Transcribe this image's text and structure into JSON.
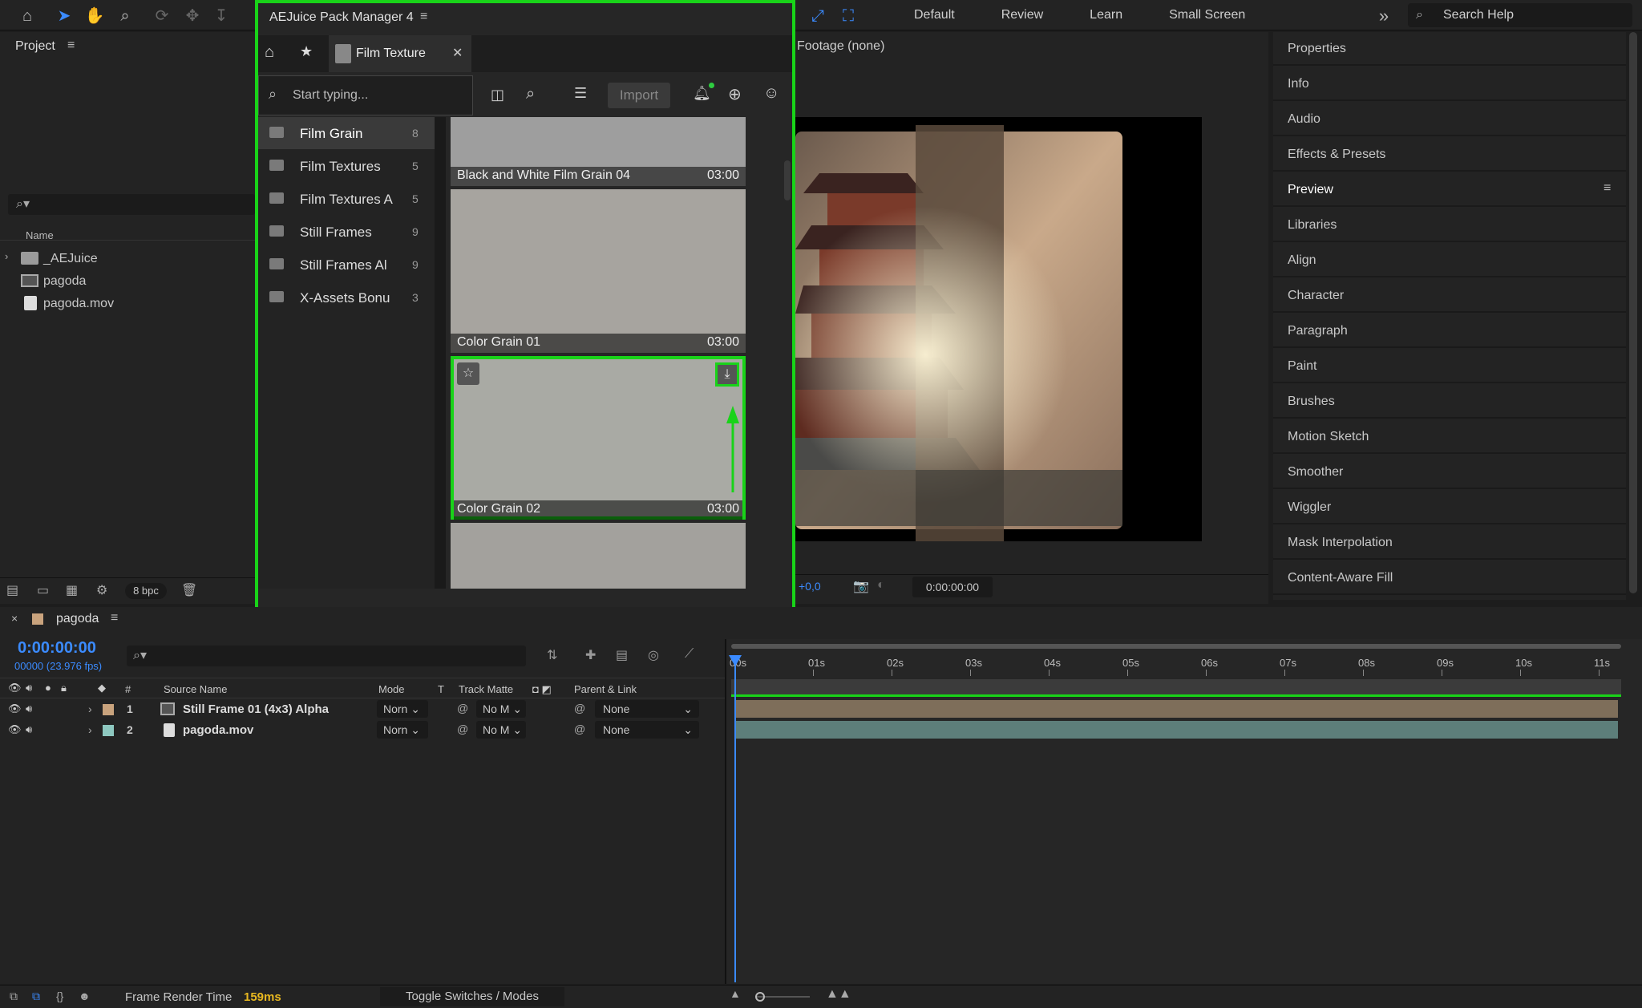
{
  "toolbar": {
    "workspaces": [
      "Default",
      "Review",
      "Learn",
      "Small Screen"
    ],
    "search_help_placeholder": "Search Help"
  },
  "project": {
    "title": "Project",
    "name_header": "Name",
    "items": [
      "_AEJuice",
      "pagoda",
      "pagoda.mov"
    ],
    "bpc": "8 bpc"
  },
  "pack_manager": {
    "title": "AEJuice Pack Manager 4",
    "tab_label": "Film Texture",
    "search_placeholder": "Start typing...",
    "import_label": "Import",
    "categories": [
      {
        "name": "Film Grain",
        "count": "8"
      },
      {
        "name": "Film Textures",
        "count": "5"
      },
      {
        "name": "Film Textures A",
        "count": "5"
      },
      {
        "name": "Still Frames",
        "count": "9"
      },
      {
        "name": "Still Frames Al",
        "count": "9"
      },
      {
        "name": "X-Assets Bonu",
        "count": "3"
      }
    ],
    "assets": [
      {
        "name": "Black and White Film Grain 04",
        "duration": "03:00"
      },
      {
        "name": "Color Grain 01",
        "duration": "03:00"
      },
      {
        "name": "Color Grain 02",
        "duration": "03:00"
      }
    ]
  },
  "viewer": {
    "footage_label": "Footage (none)",
    "exposure": "+0,0",
    "timecode": "0:00:00:00"
  },
  "right_panels": [
    "Properties",
    "Info",
    "Audio",
    "Effects & Presets",
    "Preview",
    "Libraries",
    "Align",
    "Character",
    "Paragraph",
    "Paint",
    "Brushes",
    "Motion Sketch",
    "Smoother",
    "Wiggler",
    "Mask Interpolation",
    "Content-Aware Fill"
  ],
  "timeline": {
    "comp_name": "pagoda",
    "timecode": "0:00:00:00",
    "fps": "00000 (23.976 fps)",
    "headers": {
      "num": "#",
      "source": "Source Name",
      "mode": "Mode",
      "t": "T",
      "matte": "Track Matte",
      "parent": "Parent & Link"
    },
    "ruler": [
      "00s",
      "01s",
      "02s",
      "03s",
      "04s",
      "05s",
      "06s",
      "07s",
      "08s",
      "09s",
      "10s",
      "11s"
    ],
    "layers": [
      {
        "num": "1",
        "name": "Still Frame 01 (4x3) Alpha",
        "mode": "Norn",
        "matte": "No M",
        "parent": "None",
        "color": "#c9a37d"
      },
      {
        "num": "2",
        "name": "pagoda.mov",
        "mode": "Norn",
        "matte": "No M",
        "parent": "None",
        "color": "#8ec8c0"
      }
    ]
  },
  "status": {
    "render_label": "Frame Render Time",
    "render_value": "159ms",
    "toggle_label": "Toggle Switches / Modes"
  },
  "colors": {
    "highlight": "#19d319",
    "accent_blue": "#3b8bff",
    "timecode": "#3b8bff"
  }
}
